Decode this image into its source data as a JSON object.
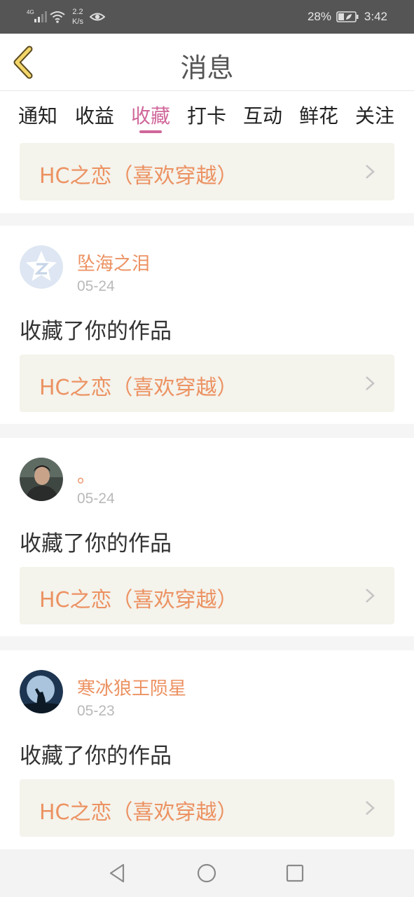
{
  "status_bar": {
    "network": "4G",
    "speed_value": "2.2",
    "speed_unit": "K/s",
    "battery": "28%",
    "time": "3:42"
  },
  "header": {
    "title": "消息",
    "back_icon": "chevron-left-icon"
  },
  "tabs": [
    {
      "label": "通知",
      "active": false
    },
    {
      "label": "收益",
      "active": false
    },
    {
      "label": "收藏",
      "active": true
    },
    {
      "label": "打卡",
      "active": false
    },
    {
      "label": "互动",
      "active": false
    },
    {
      "label": "鲜花",
      "active": false
    },
    {
      "label": "关注",
      "active": false
    }
  ],
  "feed": {
    "top_work": {
      "title": "HC之恋（喜欢穿越）"
    },
    "items": [
      {
        "user": "坠海之泪",
        "date": "05-24",
        "action": "收藏了你的作品",
        "work_title": "HC之恋（喜欢穿越）",
        "avatar_icon": "default-star-avatar"
      },
      {
        "user": "。",
        "date": "05-24",
        "action": "收藏了你的作品",
        "work_title": "HC之恋（喜欢穿越）",
        "avatar_icon": "person-photo-avatar"
      },
      {
        "user": "寒冰狼王陨星",
        "date": "05-23",
        "action": "收藏了你的作品",
        "work_title": "HC之恋（喜欢穿越）",
        "avatar_icon": "wolf-moon-avatar"
      }
    ]
  },
  "nav_bar": {
    "back_icon": "nav-back-triangle-icon",
    "home_icon": "nav-home-circle-icon",
    "recents_icon": "nav-recents-square-icon"
  },
  "colors": {
    "accent": "#d0679a",
    "work_title": "#ec9262",
    "work_box_bg": "#f4f3ec",
    "status_bar_bg": "#555555"
  }
}
